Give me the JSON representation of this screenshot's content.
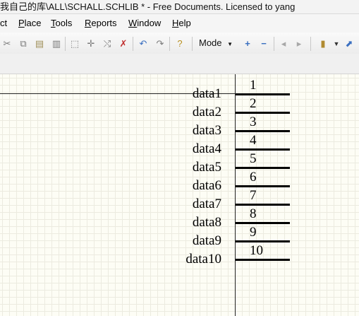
{
  "title_bar": {
    "text": "我自己的库\\ALL\\SCHALL.SCHLIB * - Free Documents. Licensed to yang"
  },
  "menu": {
    "items": [
      {
        "prefix": "",
        "underlined": "",
        "rest": "ct"
      },
      {
        "prefix": "",
        "underlined": "P",
        "rest": "lace"
      },
      {
        "prefix": "",
        "underlined": "T",
        "rest": "ools"
      },
      {
        "prefix": "",
        "underlined": "R",
        "rest": "eports"
      },
      {
        "prefix": "",
        "underlined": "W",
        "rest": "indow"
      },
      {
        "prefix": "",
        "underlined": "H",
        "rest": "elp"
      }
    ]
  },
  "toolbar": {
    "mode_label": "Mode",
    "icons": [
      "cut-icon",
      "copy-icon",
      "paste-icon",
      "clipboard-icon",
      "select-rect-icon",
      "move-icon",
      "move-selection-icon",
      "deselect-icon",
      "undo-icon",
      "redo-icon",
      "help-icon",
      "mode-dropdown",
      "add-icon",
      "remove-icon",
      "arrow-left-icon",
      "arrow-right-icon",
      "component-icon",
      "dropdown-icon",
      "chart-icon"
    ]
  },
  "schematic": {
    "pins": [
      {
        "number": "1",
        "name": "data1"
      },
      {
        "number": "2",
        "name": "data2"
      },
      {
        "number": "3",
        "name": "data3"
      },
      {
        "number": "4",
        "name": "data4"
      },
      {
        "number": "5",
        "name": "data5"
      },
      {
        "number": "6",
        "name": "data6"
      },
      {
        "number": "7",
        "name": "data7"
      },
      {
        "number": "8",
        "name": "data8"
      },
      {
        "number": "9",
        "name": "data9"
      },
      {
        "number": "10",
        "name": "data10"
      }
    ]
  }
}
